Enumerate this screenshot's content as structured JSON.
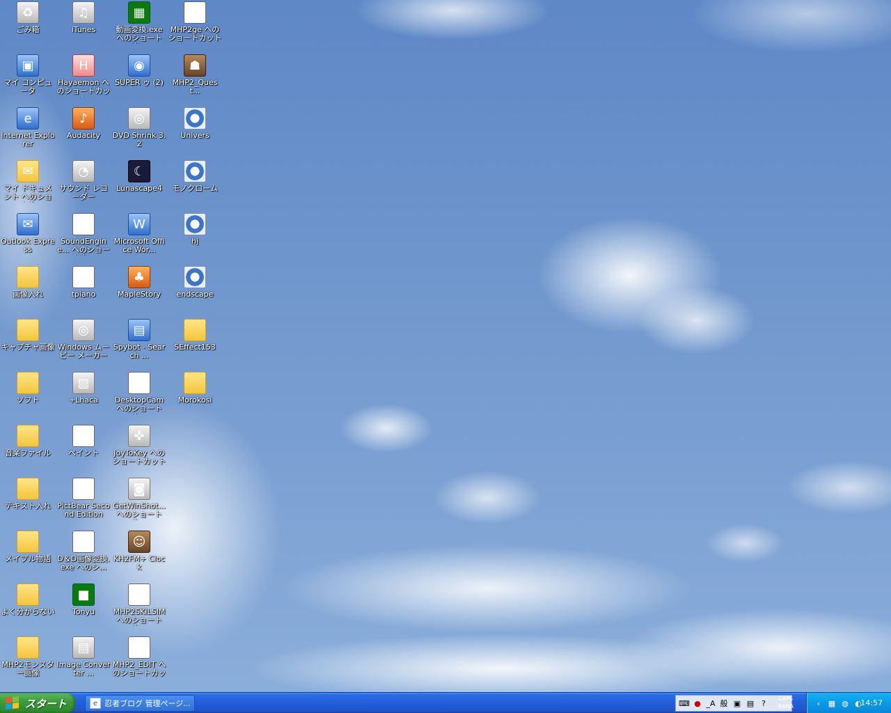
{
  "desktop": {
    "icons": [
      {
        "label": "ごみ箱",
        "icon": "recycle-bin-icon"
      },
      {
        "label": "iTunes",
        "icon": "itunes-icon"
      },
      {
        "label": "動画変換.exe へのショートカ...",
        "icon": "video-converter-icon"
      },
      {
        "label": "MHP2ge へのショートカット",
        "icon": "window-icon"
      },
      {
        "label": "マイ コンピュータ",
        "icon": "my-computer-icon"
      },
      {
        "label": "Hayaemon へのショートカット",
        "icon": "hayaemon-icon"
      },
      {
        "label": "SUPER ゥ (2)",
        "icon": "super-icon"
      },
      {
        "label": "MHP2_Quest...",
        "icon": "mhp2-quest-icon"
      },
      {
        "label": "Internet Explorer",
        "icon": "internet-explorer-icon"
      },
      {
        "label": "Audacity",
        "icon": "audacity-icon"
      },
      {
        "label": "DVD Shrink 3.2",
        "icon": "dvd-shrink-icon"
      },
      {
        "label": "Univers",
        "icon": "media-file-icon"
      },
      {
        "label": "マイ ドキュメント へのショートカ...",
        "icon": "my-documents-icon"
      },
      {
        "label": "サウンド レコーダー",
        "icon": "sound-recorder-icon"
      },
      {
        "label": "Lunascape4",
        "icon": "lunascape-icon"
      },
      {
        "label": "モノクローム",
        "icon": "media-file-icon"
      },
      {
        "label": "Outlook Express",
        "icon": "outlook-express-icon"
      },
      {
        "label": "SoundEngine... へのショートカ...",
        "icon": "soundengine-icon"
      },
      {
        "label": "Microsoft Office Wor...",
        "icon": "word-icon"
      },
      {
        "label": "hj",
        "icon": "media-file-icon"
      },
      {
        "label": "画像入れ",
        "icon": "folder-icon"
      },
      {
        "label": "tpiano",
        "icon": "piano-icon"
      },
      {
        "label": "MapleStory",
        "icon": "maplestory-icon"
      },
      {
        "label": "endscape",
        "icon": "media-file-icon"
      },
      {
        "label": "キャプチャ画像",
        "icon": "folder-icon"
      },
      {
        "label": "Windows ムービー メーカー",
        "icon": "movie-maker-icon"
      },
      {
        "label": "Spybot - Search ...",
        "icon": "spybot-icon"
      },
      {
        "label": "SEffect153",
        "icon": "folder-icon"
      },
      {
        "label": "ソフト",
        "icon": "folder-icon"
      },
      {
        "label": "+Lhaca",
        "icon": "lhaca-icon"
      },
      {
        "label": "DesktopCam へのショートカ...",
        "icon": "desktopcam-icon"
      },
      {
        "label": "Morokosi",
        "icon": "folder-icon"
      },
      {
        "label": "音楽ファイル",
        "icon": "folder-icon"
      },
      {
        "label": "ペイント",
        "icon": "paint-icon"
      },
      {
        "label": "JoyToKey への ショートカット",
        "icon": "joystick-icon"
      },
      {
        "label": "テキスト入れ",
        "icon": "folder-icon"
      },
      {
        "label": "PictBear Second Edition",
        "icon": "pictbear-icon"
      },
      {
        "label": "GetWinShot... へのショートカ...",
        "icon": "camera-icon"
      },
      {
        "label": "メイプル物語",
        "icon": "folder-icon"
      },
      {
        "label": "D＆D画像変換.exe へのシ...",
        "icon": "dd-converter-icon"
      },
      {
        "label": "KH2FM+ Clock",
        "icon": "clock-app-icon"
      },
      {
        "label": "よく分からない",
        "icon": "folder-icon"
      },
      {
        "label": "Tonyu",
        "icon": "tonyu-icon"
      },
      {
        "label": "MHP2SKILSIM へのショートカ...",
        "icon": "skill-sim-icon"
      },
      {
        "label": "MHP2モンスター画像",
        "icon": "folder-icon"
      },
      {
        "label": "Image Converter ...",
        "icon": "image-converter-icon"
      },
      {
        "label": "MHP2_EDIT へ のショートカット",
        "icon": "flag-icon"
      }
    ]
  },
  "taskbar": {
    "start_label": "スタート",
    "task_button_label": "忍者ブログ 管理ページ...",
    "ime_mode": "_A",
    "ime_kanji": "般",
    "caps": "CAPS",
    "kana": "KANA",
    "clock": "14:57"
  }
}
